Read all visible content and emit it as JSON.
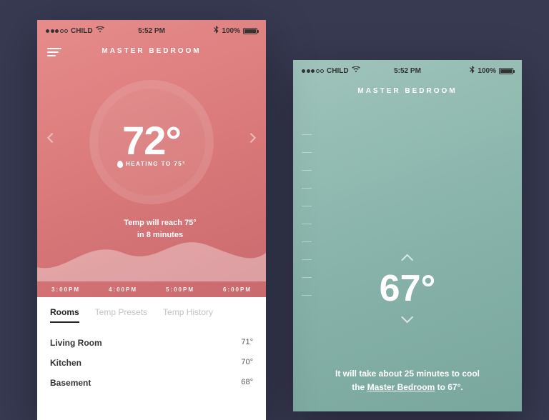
{
  "status": {
    "carrier": "CHILD",
    "time": "5:52 PM",
    "battery": "100%"
  },
  "left": {
    "title": "MASTER BEDROOM",
    "temp": "72°",
    "heating": "HEATING TO 75°",
    "forecast_l1": "Temp will reach 75°",
    "forecast_l2": "in 8 minutes",
    "timeline": [
      "3:00PM",
      "4:00PM",
      "5:00PM",
      "6:00PM"
    ],
    "tabs": [
      "Rooms",
      "Temp Presets",
      "Temp History"
    ],
    "rooms": [
      {
        "name": "Living Room",
        "temp": "71°"
      },
      {
        "name": "Kitchen",
        "temp": "70°"
      },
      {
        "name": "Basement",
        "temp": "68°"
      }
    ]
  },
  "right": {
    "title": "MASTER BEDROOM",
    "set": "67°",
    "note_pre": "It will take about 25 minutes to cool",
    "note_mid": "the ",
    "note_room": "Master Bedroom",
    "note_post": " to 67°."
  }
}
